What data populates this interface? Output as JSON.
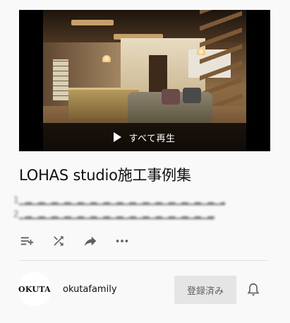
{
  "playlist": {
    "play_all_label": "すべて再生",
    "title": "LOHAS studio施工事例集",
    "meta_line_1": "1",
    "meta_line_2": "2"
  },
  "actions": [
    {
      "icon": "playlist-add-icon"
    },
    {
      "icon": "shuffle-icon"
    },
    {
      "icon": "share-icon"
    },
    {
      "icon": "more-horizontal-icon"
    }
  ],
  "channel": {
    "avatar_text": "OKUTA",
    "name": "okutafamily",
    "subscribe_label": "登録済み"
  },
  "colors": {
    "background": "#f9f9f9",
    "subscribe_bg": "#e5e5e5",
    "icon": "#606060"
  }
}
